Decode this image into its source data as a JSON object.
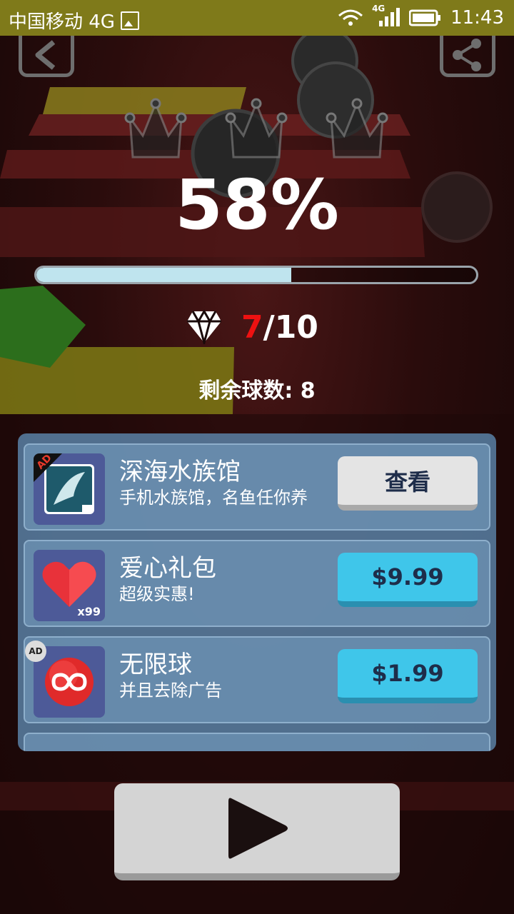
{
  "status_bar": {
    "carrier": "中国移动 4G",
    "network_badge": "4G",
    "time": "11:43",
    "icons": [
      "image-icon",
      "wifi-icon",
      "signal-icon",
      "battery-icon"
    ]
  },
  "header": {
    "back_icon": "back-arrow-icon",
    "share_icon": "share-icon"
  },
  "level_result": {
    "crowns_total": 3,
    "crowns_earned": 0,
    "percent_text": "58%",
    "progress": 0.58,
    "gems_current": "7",
    "gems_total": "/10",
    "balls_left_text": "剩余球数: 8"
  },
  "shop": {
    "items": [
      {
        "title": "深海水族馆",
        "subtitle": "手机水族馆，名鱼任你养",
        "button": "查看",
        "badge": "AD",
        "icon": "aquarium-app-icon"
      },
      {
        "title": "爱心礼包",
        "subtitle": "超级实惠!",
        "button": "$9.99",
        "quantity": "x99",
        "icon": "heart-icon"
      },
      {
        "title": "无限球",
        "subtitle": "并且去除广告",
        "button": "$1.99",
        "badge": "AD",
        "icon": "infinity-ball-icon"
      }
    ]
  },
  "play": {
    "icon": "play-icon"
  },
  "colors": {
    "status_bar": "#7f7a1a",
    "progress_fill": "#bfe4ee",
    "gem_current": "#ee1111",
    "buy_button": "#3fc6ea",
    "panel": "#5f8cb4"
  }
}
